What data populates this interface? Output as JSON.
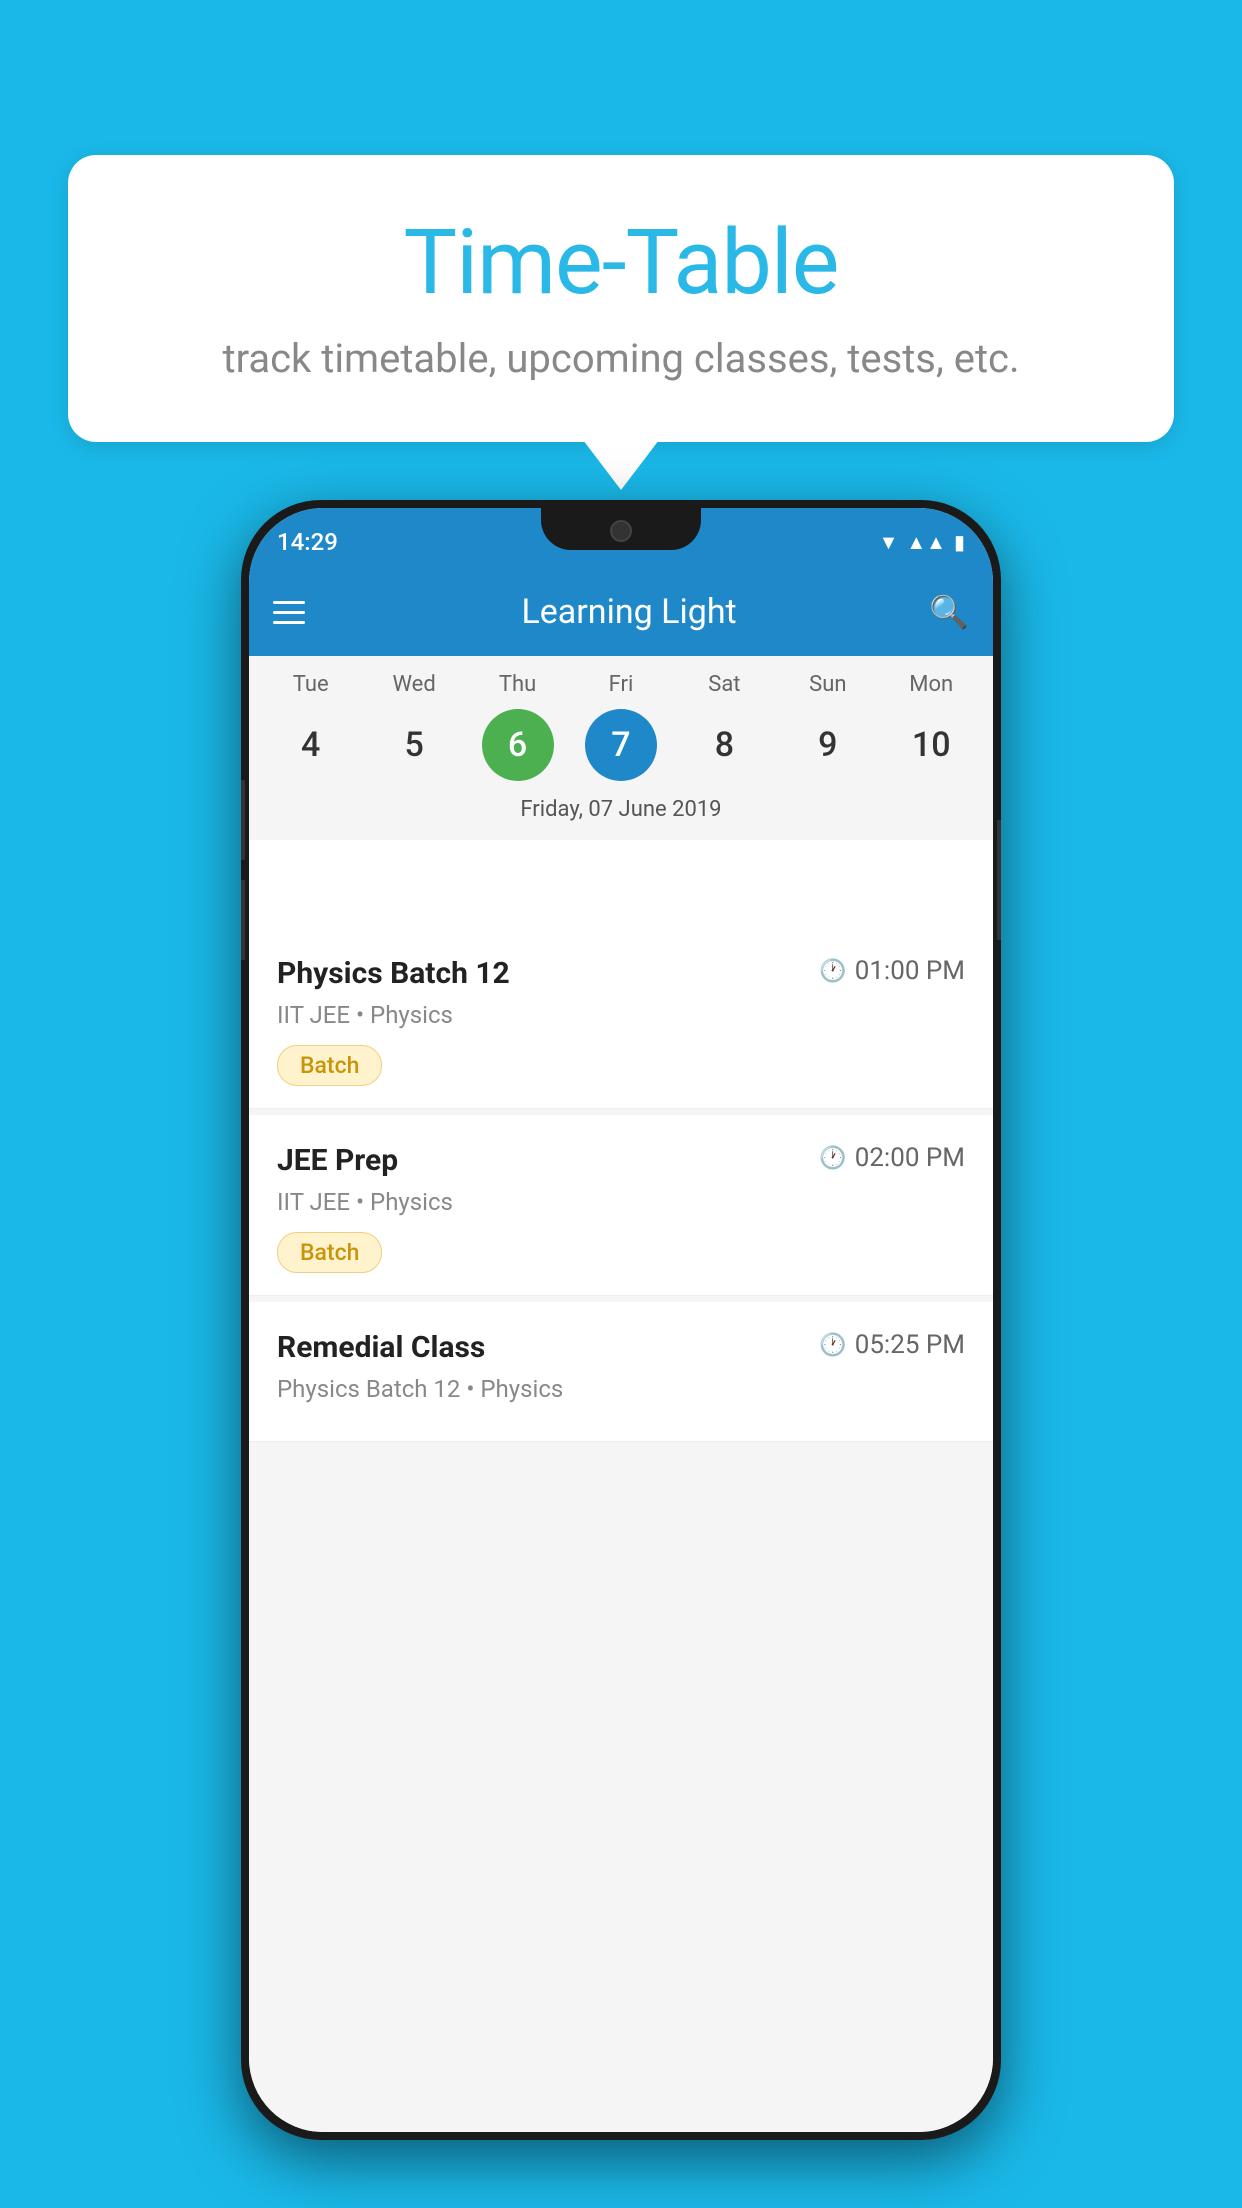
{
  "background_color": "#1ab8e8",
  "bubble": {
    "title": "Time-Table",
    "subtitle": "track timetable, upcoming classes, tests, etc."
  },
  "phone": {
    "status_bar": {
      "time": "14:29",
      "wifi": "▼",
      "signal": "▲",
      "battery": "▮"
    },
    "header": {
      "title": "Learning Light",
      "menu_label": "menu",
      "search_label": "search"
    },
    "calendar": {
      "days": [
        {
          "label": "Tue",
          "number": "4",
          "state": "normal"
        },
        {
          "label": "Wed",
          "number": "5",
          "state": "normal"
        },
        {
          "label": "Thu",
          "number": "6",
          "state": "today"
        },
        {
          "label": "Fri",
          "number": "7",
          "state": "selected"
        },
        {
          "label": "Sat",
          "number": "8",
          "state": "normal"
        },
        {
          "label": "Sun",
          "number": "9",
          "state": "normal"
        },
        {
          "label": "Mon",
          "number": "10",
          "state": "normal"
        }
      ],
      "selected_date": "Friday, 07 June 2019"
    },
    "classes": [
      {
        "name": "Physics Batch 12",
        "time": "01:00 PM",
        "subtitle": "IIT JEE • Physics",
        "badge": "Batch"
      },
      {
        "name": "JEE Prep",
        "time": "02:00 PM",
        "subtitle": "IIT JEE • Physics",
        "badge": "Batch"
      },
      {
        "name": "Remedial Class",
        "time": "05:25 PM",
        "subtitle": "Physics Batch 12 • Physics",
        "badge": ""
      }
    ]
  }
}
